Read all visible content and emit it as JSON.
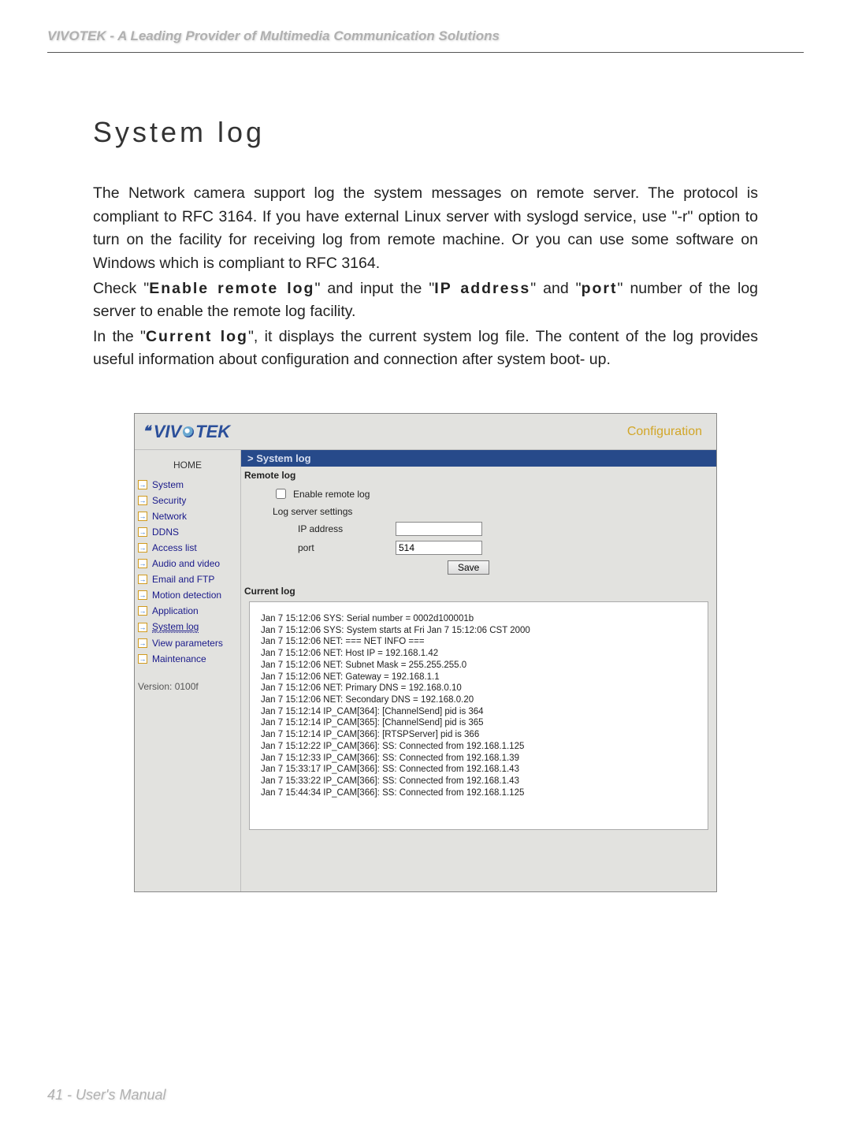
{
  "doc": {
    "header": "VIVOTEK - A Leading Provider of Multimedia Communication Solutions",
    "title": "System log",
    "para1": "The Network camera support log the system messages on remote server. The protocol is compliant to RFC 3164. If you have external Linux server with syslogd service, use \"-r\" option to turn on the facility for receiving log from remote machine. Or you can use some software on Windows which is compliant to RFC 3164.",
    "para2a": "Check \"",
    "para2bold1": "Enable remote log",
    "para2b": "\" and input the \"",
    "para2bold2": "IP address",
    "para2c": "\" and \"",
    "para2bold3": "port",
    "para2d": "\" number of the log server to enable the remote log facility.",
    "para3a": "In the \"",
    "para3bold": "Current log",
    "para3b": "\", it displays the current system log file. The content of the log provides useful information about configuration and connection after system boot- up.",
    "footer": "41 - User's Manual"
  },
  "ui": {
    "logo": "VIV   TEK",
    "config": "Configuration",
    "crumb": "> System log",
    "home": "HOME",
    "nav": [
      "System",
      "Security",
      "Network",
      "DDNS",
      "Access list",
      "Audio and video",
      "Email and FTP",
      "Motion detection",
      "Application",
      "System log",
      "View parameters",
      "Maintenance"
    ],
    "version": "Version: 0100f",
    "remote_log_head": "Remote log",
    "enable_label": "Enable remote log",
    "log_server_settings": "Log server settings",
    "ip_label": "IP address",
    "port_label": "port",
    "port_value": "514",
    "save": "Save",
    "current_log_head": "Current log",
    "log_lines": "Jan 7 15:12:06 SYS: Serial number = 0002d100001b\nJan 7 15:12:06 SYS: System starts at Fri Jan 7 15:12:06 CST 2000\nJan 7 15:12:06 NET: === NET INFO ===\nJan 7 15:12:06 NET: Host IP = 192.168.1.42\nJan 7 15:12:06 NET: Subnet Mask = 255.255.255.0\nJan 7 15:12:06 NET: Gateway = 192.168.1.1\nJan 7 15:12:06 NET: Primary DNS = 192.168.0.10\nJan 7 15:12:06 NET: Secondary DNS = 192.168.0.20\nJan 7 15:12:14 IP_CAM[364]: [ChannelSend] pid is 364\nJan 7 15:12:14 IP_CAM[365]: [ChannelSend] pid is 365\nJan 7 15:12:14 IP_CAM[366]: [RTSPServer] pid is 366\nJan 7 15:12:22 IP_CAM[366]: SS: Connected from 192.168.1.125\nJan 7 15:12:33 IP_CAM[366]: SS: Connected from 192.168.1.39\nJan 7 15:33:17 IP_CAM[366]: SS: Connected from 192.168.1.43\nJan 7 15:33:22 IP_CAM[366]: SS: Connected from 192.168.1.43\nJan 7 15:44:34 IP_CAM[366]: SS: Connected from 192.168.1.125"
  }
}
